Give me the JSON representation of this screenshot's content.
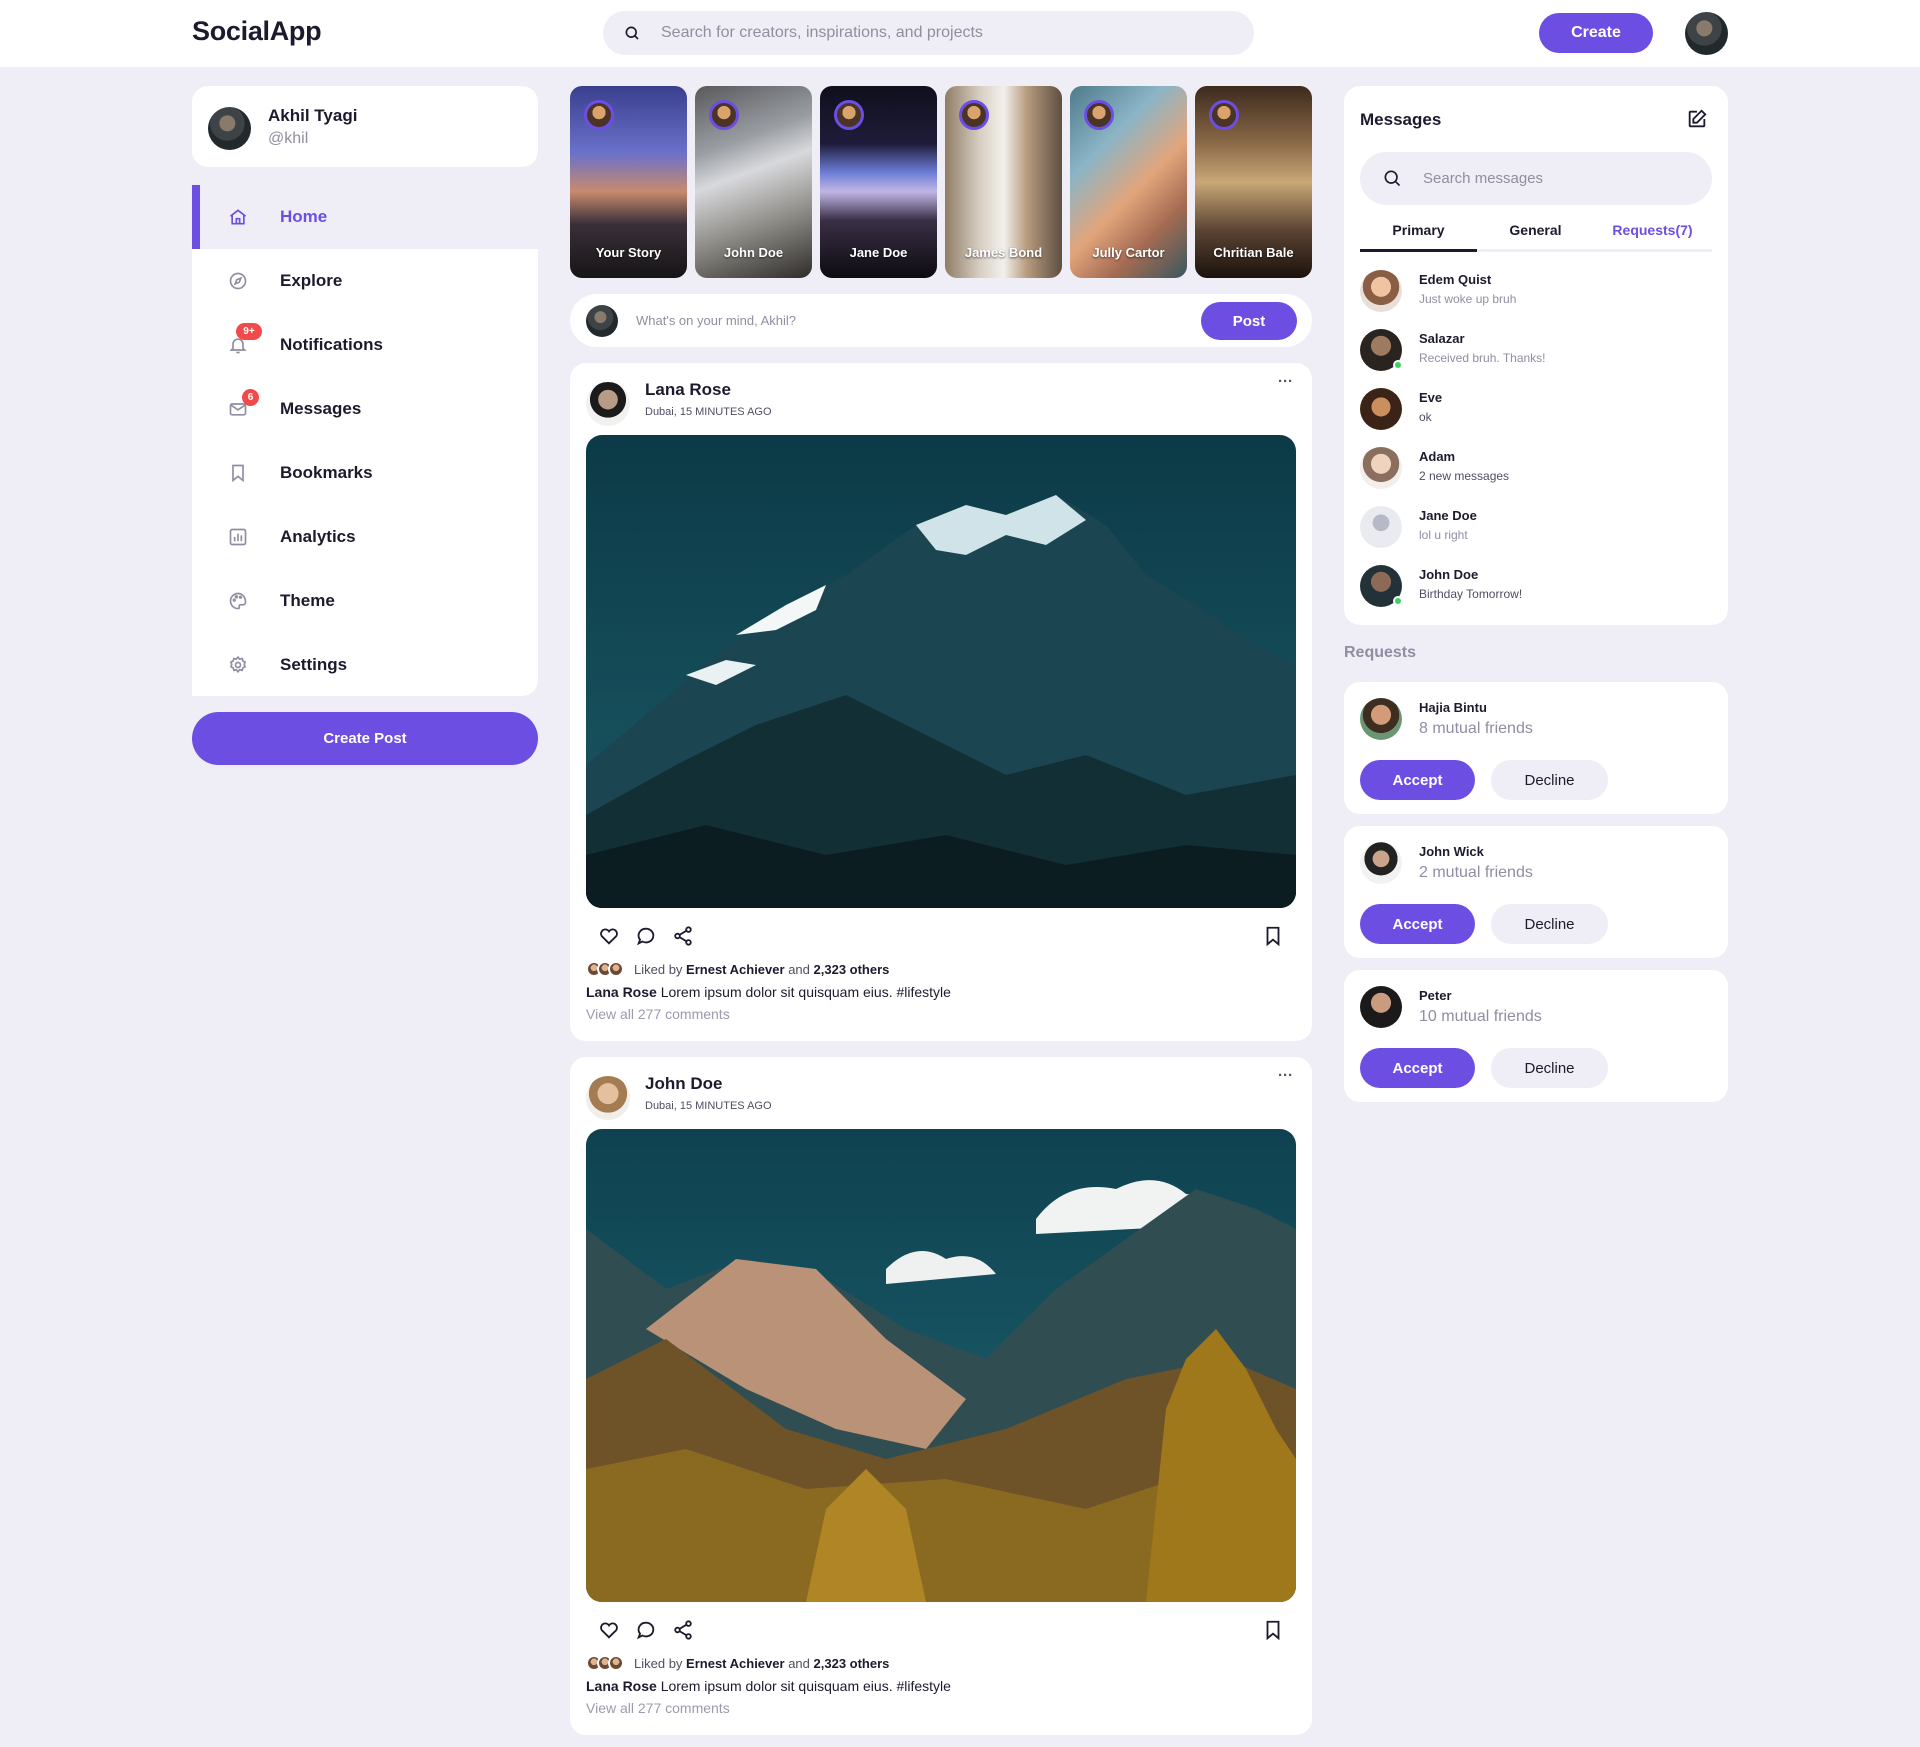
{
  "app": {
    "name": "SocialApp"
  },
  "search": {
    "placeholder": "Search for creators, inspirations, and projects"
  },
  "header": {
    "create_label": "Create",
    "avatar_icon": "user-avatar"
  },
  "profile": {
    "name": "Akhil Tyagi",
    "handle": "@khil"
  },
  "sidebar": {
    "items": [
      {
        "label": "Home",
        "icon": "home-icon",
        "active": true
      },
      {
        "label": "Explore",
        "icon": "compass-icon"
      },
      {
        "label": "Notifications",
        "icon": "bell-icon",
        "badge": "9+"
      },
      {
        "label": "Messages",
        "icon": "mail-icon",
        "badge": "6"
      },
      {
        "label": "Bookmarks",
        "icon": "bookmark-icon"
      },
      {
        "label": "Analytics",
        "icon": "chart-icon"
      },
      {
        "label": "Theme",
        "icon": "palette-icon"
      },
      {
        "label": "Settings",
        "icon": "gear-icon"
      }
    ],
    "create_post_label": "Create Post"
  },
  "stories": [
    {
      "label": "Your Story"
    },
    {
      "label": "John Doe"
    },
    {
      "label": "Jane Doe"
    },
    {
      "label": "James Bond"
    },
    {
      "label": "Jully Cartor"
    },
    {
      "label": "Chritian Bale"
    }
  ],
  "composer": {
    "placeholder": "What's on your mind, Akhil?",
    "post_label": "Post"
  },
  "posts": [
    {
      "author": "Lana Rose",
      "meta": "Dubai, 15 MINUTES AGO",
      "more": "···",
      "liked_prefix": "Liked by ",
      "liked_name": "Ernest Achiever",
      "liked_mid": " and ",
      "liked_others": "2,323 others",
      "caption_author": "Lana Rose",
      "caption_text": " Lorem ipsum dolor sit quisquam eius. #lifestyle",
      "view_all": "View all 277 comments"
    },
    {
      "author": "John Doe",
      "meta": "Dubai, 15 MINUTES AGO",
      "more": "···",
      "liked_prefix": "Liked by ",
      "liked_name": "Ernest Achiever",
      "liked_mid": " and ",
      "liked_others": "2,323 others",
      "caption_author": "Lana Rose",
      "caption_text": " Lorem ipsum dolor sit quisquam eius. #lifestyle",
      "view_all": "View all 277 comments"
    }
  ],
  "messages": {
    "title": "Messages",
    "search_placeholder": "Search messages",
    "tabs": [
      "Primary",
      "General",
      "Requests(7)"
    ],
    "items": [
      {
        "name": "Edem Quist",
        "text": "Just woke up bruh",
        "online": false
      },
      {
        "name": "Salazar",
        "text": "Received bruh. Thanks!",
        "online": true
      },
      {
        "name": "Eve",
        "text": "ok",
        "online": false
      },
      {
        "name": "Adam",
        "text": "2 new messages",
        "online": false
      },
      {
        "name": "Jane Doe",
        "text": "lol u right",
        "online": false
      },
      {
        "name": "John Doe",
        "text": "Birthday Tomorrow!",
        "online": true
      }
    ]
  },
  "requests": {
    "title": "Requests",
    "accept_label": "Accept",
    "decline_label": "Decline",
    "items": [
      {
        "name": "Hajia Bintu",
        "mutual": "8 mutual friends"
      },
      {
        "name": "John Wick",
        "mutual": "2 mutual friends"
      },
      {
        "name": "Peter",
        "mutual": "10 mutual friends"
      }
    ]
  },
  "colors": {
    "accent": "#6c4ee3",
    "background": "#efeef7",
    "online": "#3cd25e",
    "badge": "#f24a4a"
  }
}
